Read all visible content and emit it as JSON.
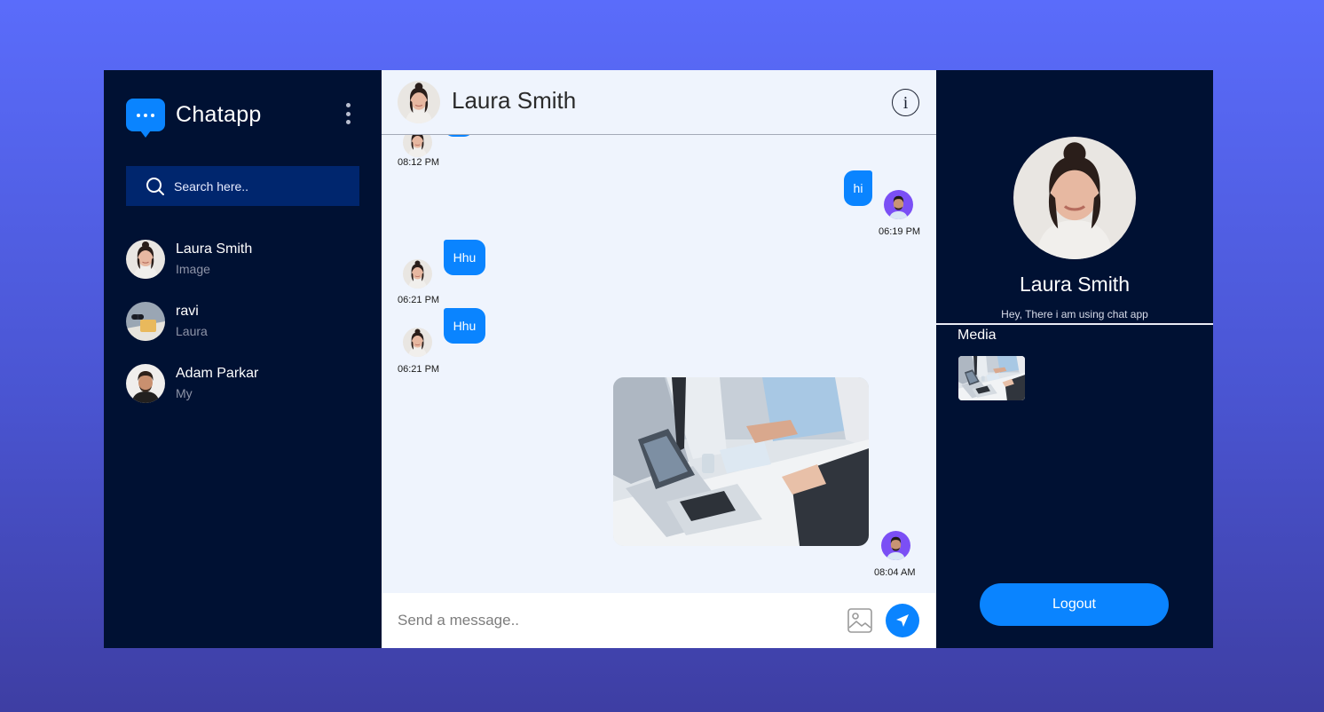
{
  "app": {
    "name": "Chatapp"
  },
  "search": {
    "placeholder": "Search here.."
  },
  "contacts": [
    {
      "name": "Laura Smith",
      "last_message": "Image"
    },
    {
      "name": "ravi",
      "last_message": "Laura"
    },
    {
      "name": "Adam Parkar",
      "last_message": "My"
    }
  ],
  "chat": {
    "title": "Laura Smith",
    "messages": [
      {
        "from": "contact",
        "type": "text",
        "text": "",
        "time": "08:12 PM"
      },
      {
        "from": "me",
        "type": "text",
        "text": "hi",
        "time": "06:19 PM"
      },
      {
        "from": "contact",
        "type": "text",
        "text": "Hhu",
        "time": "06:21 PM"
      },
      {
        "from": "contact",
        "type": "text",
        "text": "Hhu",
        "time": "06:21 PM"
      },
      {
        "from": "me",
        "type": "image",
        "text": "",
        "time": "08:04 AM"
      }
    ]
  },
  "composer": {
    "placeholder": "Send a message.."
  },
  "profile": {
    "name": "Laura Smith",
    "status": "Hey, There i am using chat app",
    "media_label": "Media",
    "logout_label": "Logout"
  },
  "colors": {
    "accent": "#0a84ff",
    "sidebar_bg": "#001133",
    "search_bg": "#00266e",
    "chat_bg": "#eff4fd",
    "page_gradient_top": "#5a6cfb",
    "page_gradient_bottom": "#3e3ea3"
  },
  "icons": [
    "chat-bubble-icon",
    "more-vertical-icon",
    "search-icon",
    "info-icon",
    "image-icon",
    "send-icon"
  ]
}
